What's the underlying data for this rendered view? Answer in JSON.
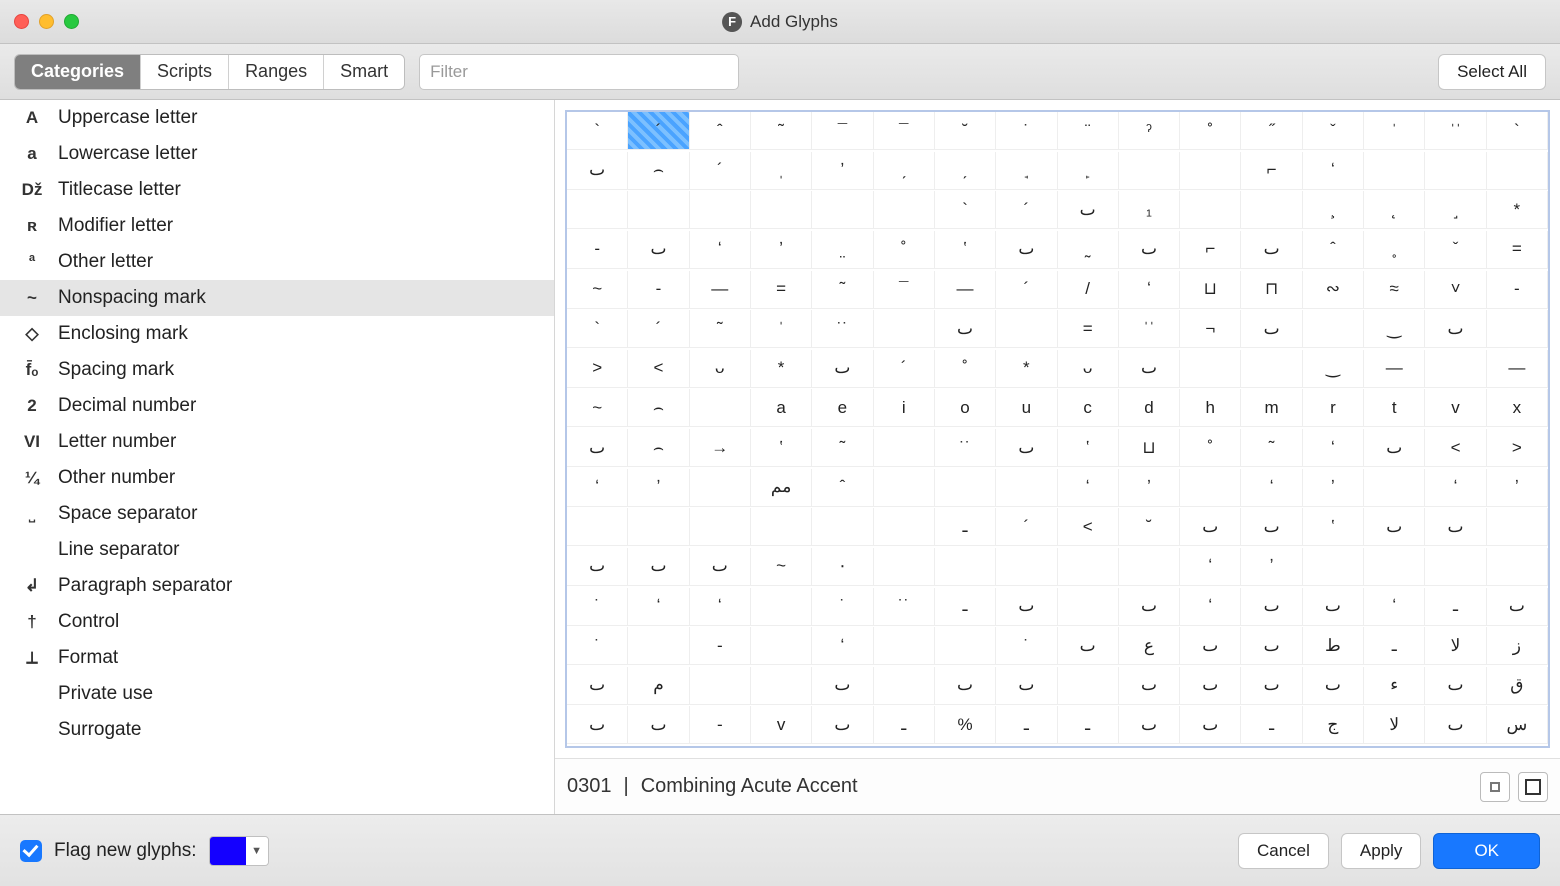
{
  "window": {
    "title": "Add Glyphs"
  },
  "toolbar": {
    "tabs": [
      "Categories",
      "Scripts",
      "Ranges",
      "Smart"
    ],
    "active_tab_index": 0,
    "filter_placeholder": "Filter",
    "select_all": "Select All"
  },
  "sidebar": {
    "items": [
      {
        "icon": "A",
        "label": "Uppercase letter"
      },
      {
        "icon": "a",
        "label": "Lowercase letter"
      },
      {
        "icon": "Dž",
        "label": "Titlecase letter"
      },
      {
        "icon": "ʀ",
        "label": "Modifier letter"
      },
      {
        "icon": "ª",
        "label": "Other letter"
      },
      {
        "icon": "~",
        "label": "Nonspacing mark"
      },
      {
        "icon": "◇",
        "label": "Enclosing mark"
      },
      {
        "icon": "f̄ₒ",
        "label": "Spacing mark"
      },
      {
        "icon": "2",
        "label": "Decimal number"
      },
      {
        "icon": "VI",
        "label": "Letter number"
      },
      {
        "icon": "¼",
        "label": "Other number"
      },
      {
        "icon": "˽",
        "label": "Space separator"
      },
      {
        "icon": "",
        "label": "Line separator"
      },
      {
        "icon": "↲",
        "label": "Paragraph separator"
      },
      {
        "icon": "†",
        "label": "Control"
      },
      {
        "icon": "⟂",
        "label": "Format"
      },
      {
        "icon": "",
        "label": "Private use"
      },
      {
        "icon": "",
        "label": "Surrogate"
      }
    ],
    "selected_index": 5
  },
  "glyph_grid": {
    "selected_index": 1,
    "rows": [
      [
        "`",
        "´",
        "ˆ",
        "˜",
        "¯",
        "¯",
        "˘",
        "˙",
        "¨",
        "ˀ",
        "˚",
        "˝",
        "ˇ",
        "ˈ",
        "ˈˈ",
        "`"
      ],
      [
        "ٮ",
        "⌢",
        "´",
        "ˌ",
        "ʼ",
        "ˏ",
        "̗",
        "̘",
        "̙",
        "",
        "",
        "⌐",
        "ʻ",
        "",
        "",
        ""
      ],
      [
        "",
        "",
        "",
        "",
        "",
        "",
        "`",
        "´",
        "ٮ",
        "₁",
        "",
        "",
        "¸",
        "˛",
        "˼",
        "*"
      ],
      [
        "-",
        "ٮ",
        "ʻ",
        "ʼ",
        "̤",
        "˚",
        "ʽ",
        "ٮ",
        "̰",
        "ٮ",
        "⌐",
        "ٮ",
        "ˆ",
        "˳",
        "ˇ",
        "="
      ],
      [
        "~",
        "-",
        "—",
        "=",
        "˜",
        "¯",
        "—",
        "´",
        "/",
        "ʻ",
        "⊔",
        "⊓",
        "∾",
        "≈",
        "˅",
        "-"
      ],
      [
        "`",
        "´",
        "˜",
        "ˈ",
        "˙˙",
        "",
        "ٮ",
        "",
        "=",
        "ˈˈ",
        "¬",
        "ٮ",
        "",
        "‿",
        "ٮ",
        ""
      ],
      [
        ">",
        "<",
        "ᴗ",
        "*",
        "ٮ",
        "´",
        "˚",
        "*",
        "ᴗ",
        "ٮ",
        "",
        "",
        "‿",
        "—",
        "",
        "—"
      ],
      [
        "~",
        "⌢",
        "",
        "a",
        "e",
        "i",
        "o",
        "u",
        "c",
        "d",
        "h",
        "m",
        "r",
        "t",
        "v",
        "x"
      ],
      [
        "ٮ",
        "⌢",
        "→",
        "ʽ",
        "˜",
        "",
        "˙˙",
        "ٮ",
        "ʽ",
        "⊔",
        "˚",
        "˜",
        "ʻ",
        "ٮ",
        "<",
        ">"
      ],
      [
        "ʻ",
        "ʼ",
        "",
        "مم",
        "ˆ",
        "",
        "",
        "",
        "ʻ",
        "ʼ",
        "",
        "ʻ",
        "ʼ",
        "",
        "ʻ",
        "ʼ"
      ],
      [
        "",
        "",
        "",
        "",
        "",
        "",
        "ـ",
        "´",
        "<",
        "˘",
        "ٮ",
        "ٮ",
        "ʽ",
        "ٮ",
        "ٮ",
        ""
      ],
      [
        "ٮ",
        "ٮ",
        "ٮ",
        "~",
        "۰",
        "",
        "",
        "",
        "",
        "",
        "ʻ",
        "ʼ",
        "",
        "",
        "",
        ""
      ],
      [
        "˙",
        "ʻ",
        "ʻ",
        "",
        "˙",
        "˙˙",
        "ـ",
        "ٮ",
        "",
        "ٮ",
        "ʻ",
        "ٮ",
        "ٮ",
        "ʻ",
        "ـ",
        "ٮ"
      ],
      [
        "˙",
        "",
        "-",
        "",
        "ʻ",
        "",
        "",
        "˙",
        "ٮ",
        "ع",
        "ٮ",
        "ٮ",
        "ط",
        "ـ",
        "لا",
        "ز"
      ],
      [
        "ٮ",
        "م",
        "",
        "",
        "ٮ",
        "",
        "ٮ",
        "ٮ",
        "",
        "ٮ",
        "ٮ",
        "ٮ",
        "ٮ",
        "ء",
        "ٮ",
        "ق"
      ],
      [
        "ٮ",
        "ٮ",
        "-",
        "v",
        "ٮ",
        "ـ",
        "%",
        "ـ",
        "ـ",
        "ٮ",
        "ٮ",
        "ـ",
        "ج",
        "لا",
        "ٮ",
        "س"
      ]
    ]
  },
  "status": {
    "code": "0301",
    "sep": "|",
    "name": "Combining Acute Accent"
  },
  "footer": {
    "flag_label": "Flag new glyphs:",
    "flag_checked": true,
    "swatch_color": "#1400ff",
    "cancel": "Cancel",
    "apply": "Apply",
    "ok": "OK"
  }
}
